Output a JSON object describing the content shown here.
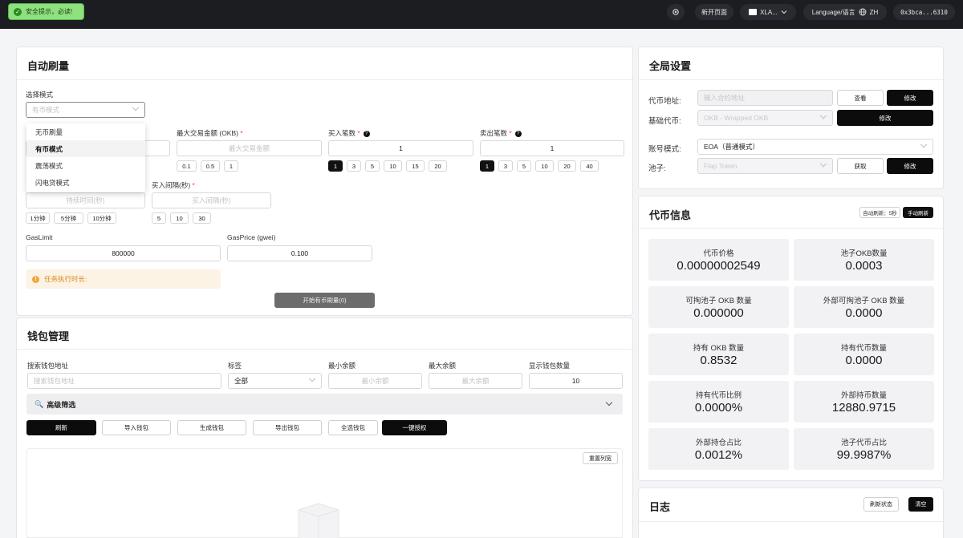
{
  "topbar": {
    "alert": "安全提示，必读!",
    "new_page": "新开页面",
    "chain": "XLA...",
    "language": "Language/语言",
    "lang_code": "ZH",
    "address": "0x3bca...6310"
  },
  "auto": {
    "title": "自动刷量",
    "mode_label": "选择模式",
    "mode_value": "有币模式",
    "modes": [
      "无币刷量",
      "有币模式",
      "震荡模式",
      "闪电贷模式"
    ],
    "max_amount_label": "最大交易金额 (OKB)",
    "max_amount_placeholder": "最大交易金额",
    "max_amount_chips": [
      "0.1",
      "0.5",
      "1"
    ],
    "buy_count_label": "买入笔数",
    "buy_count_value": "1",
    "buy_chips": [
      "1",
      "3",
      "5",
      "10",
      "15",
      "20"
    ],
    "sell_count_label": "卖出笔数",
    "sell_count_value": "1",
    "sell_chips": [
      "1",
      "3",
      "5",
      "10",
      "20",
      "40"
    ],
    "duration_placeholder": "持续时间(秒)",
    "duration_chips": [
      "1分钟",
      "5分钟",
      "10分钟"
    ],
    "interval_label": "买入间隔(秒)",
    "interval_placeholder": "买入间隔(秒)",
    "interval_chips": [
      "5",
      "10",
      "30"
    ],
    "gaslimit_label": "GasLimit",
    "gaslimit_value": "800000",
    "gasprice_label": "GasPrice (gwei)",
    "gasprice_value": "0.100",
    "warning": "任务执行时长:",
    "start_button": "开始有币刷量(0)"
  },
  "wallet": {
    "title": "钱包管理",
    "search_label": "搜索钱包地址",
    "search_placeholder": "搜索钱包地址",
    "tag_label": "标签",
    "tag_value": "全部",
    "min_label": "最小余额",
    "min_placeholder": "最小余额",
    "max_label": "最大余额",
    "max_placeholder": "最大余额",
    "count_label": "显示钱包数量",
    "count_value": "10",
    "advanced": "高级筛选",
    "buttons": [
      "刷新",
      "导入钱包",
      "生成钱包",
      "导出钱包",
      "全选钱包",
      "一键授权"
    ],
    "reset_columns": "重置列宽"
  },
  "global": {
    "title": "全局设置",
    "token_addr_label": "代币地址:",
    "token_addr_placeholder": "输入合约地址",
    "view_button": "查看",
    "edit_button": "修改",
    "base_label": "基础代币:",
    "base_value": "OKB - Wrapped OKB",
    "base_edit": "修改",
    "account_label": "账号模式:",
    "account_value": "EOA（普通模式）",
    "pool_label": "池子:",
    "pool_value": "Flap Token",
    "fetch_button": "获取",
    "pool_edit": "修改"
  },
  "token_info": {
    "title": "代币信息",
    "auto_refresh": "自动刷新：5秒",
    "manual_refresh": "手动刷新",
    "stats": [
      {
        "label": "代币价格",
        "value": "0.00000002549"
      },
      {
        "label": "池子OKB数量",
        "value": "0.0003"
      },
      {
        "label": "可掏池子 OKB 数量",
        "value": "0.000000"
      },
      {
        "label": "外部可掏池子 OKB 数量",
        "value": "0.0000"
      },
      {
        "label": "持有 OKB 数量",
        "value": "0.8532"
      },
      {
        "label": "持有代币数量",
        "value": "0.0000"
      },
      {
        "label": "持有代币比例",
        "value": "0.0000%"
      },
      {
        "label": "外部持币数量",
        "value": "12880.9715"
      },
      {
        "label": "外部持仓占比",
        "value": "0.0012%"
      },
      {
        "label": "池子代币占比",
        "value": "99.9987%"
      }
    ]
  },
  "log": {
    "title": "日志",
    "refresh_status": "刷新状态",
    "clear": "清空"
  }
}
